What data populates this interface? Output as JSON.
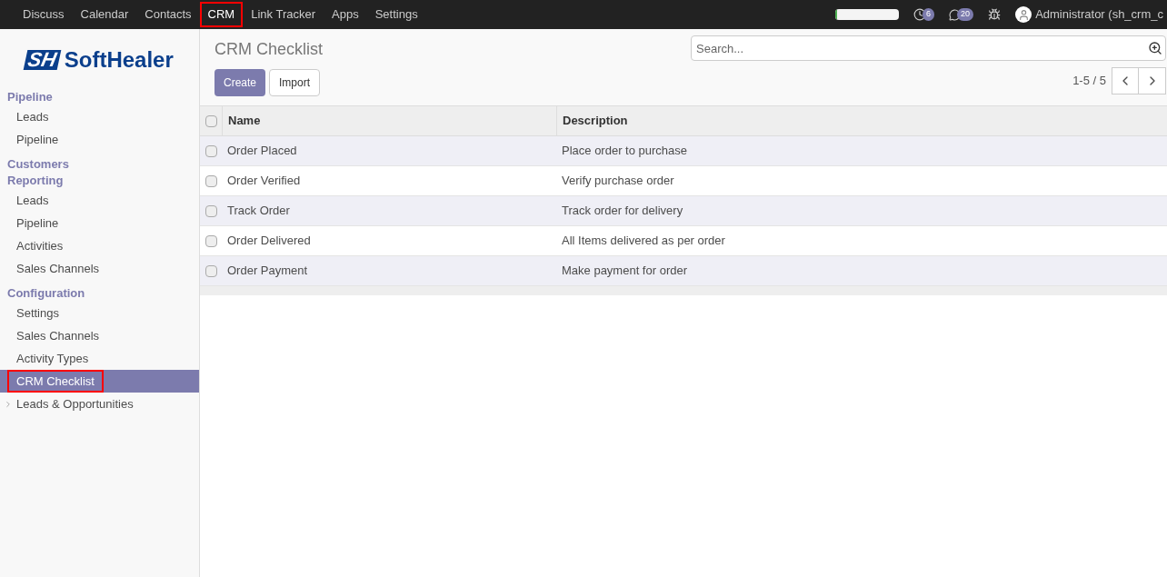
{
  "top_menu": [
    {
      "label": "Discuss",
      "selected": false,
      "highlighted": false
    },
    {
      "label": "Calendar",
      "selected": false,
      "highlighted": false
    },
    {
      "label": "Contacts",
      "selected": false,
      "highlighted": false
    },
    {
      "label": "CRM",
      "selected": true,
      "highlighted": true
    },
    {
      "label": "Link Tracker",
      "selected": false,
      "highlighted": false
    },
    {
      "label": "Apps",
      "selected": false,
      "highlighted": false
    },
    {
      "label": "Settings",
      "selected": false,
      "highlighted": false
    }
  ],
  "systray": {
    "progress": {
      "level": 0.03
    },
    "activities_count": "6",
    "messages_count": "20",
    "user": "Administrator (sh_crm_c"
  },
  "logo": {
    "mark": "SH",
    "name": "SoftHealer"
  },
  "sidebar": [
    {
      "heading": "Pipeline",
      "items": [
        {
          "label": "Leads",
          "selected": false,
          "highlighted": false
        },
        {
          "label": "Pipeline",
          "selected": false,
          "highlighted": false
        }
      ]
    },
    {
      "heading": "Customers"
    },
    {
      "heading": "Reporting",
      "items": [
        {
          "label": "Leads",
          "selected": false,
          "highlighted": false
        },
        {
          "label": "Pipeline",
          "selected": false,
          "highlighted": false
        },
        {
          "label": "Activities",
          "selected": false,
          "highlighted": false
        },
        {
          "label": "Sales Channels",
          "selected": false,
          "highlighted": false
        }
      ]
    },
    {
      "heading": "Configuration",
      "items": [
        {
          "label": "Settings",
          "selected": false,
          "highlighted": false
        },
        {
          "label": "Sales Channels",
          "selected": false,
          "highlighted": false
        },
        {
          "label": "Activity Types",
          "selected": false,
          "highlighted": false
        },
        {
          "label": "CRM Checklist",
          "selected": true,
          "highlighted": true
        }
      ]
    }
  ],
  "sidebar_tree": [
    {
      "label": "Leads & Opportunities",
      "expanded": false
    }
  ],
  "page": {
    "title": "CRM Checklist",
    "search_placeholder": "Search...",
    "buttons": [
      "Create",
      "Import"
    ],
    "pager": "1-5 / 5"
  },
  "table": {
    "select_all_checked": false,
    "columns": [
      "Name",
      "Description"
    ],
    "rows": [
      {
        "checked": false,
        "cells": [
          "Order Placed",
          "Place order to purchase"
        ]
      },
      {
        "checked": false,
        "cells": [
          "Order Verified",
          "Verify purchase order"
        ]
      },
      {
        "checked": false,
        "cells": [
          "Track Order",
          "Track order for delivery"
        ]
      },
      {
        "checked": false,
        "cells": [
          "Order Delivered",
          "All Items delivered as per order"
        ]
      },
      {
        "checked": false,
        "cells": [
          "Order Payment",
          "Make payment for order"
        ]
      }
    ]
  }
}
